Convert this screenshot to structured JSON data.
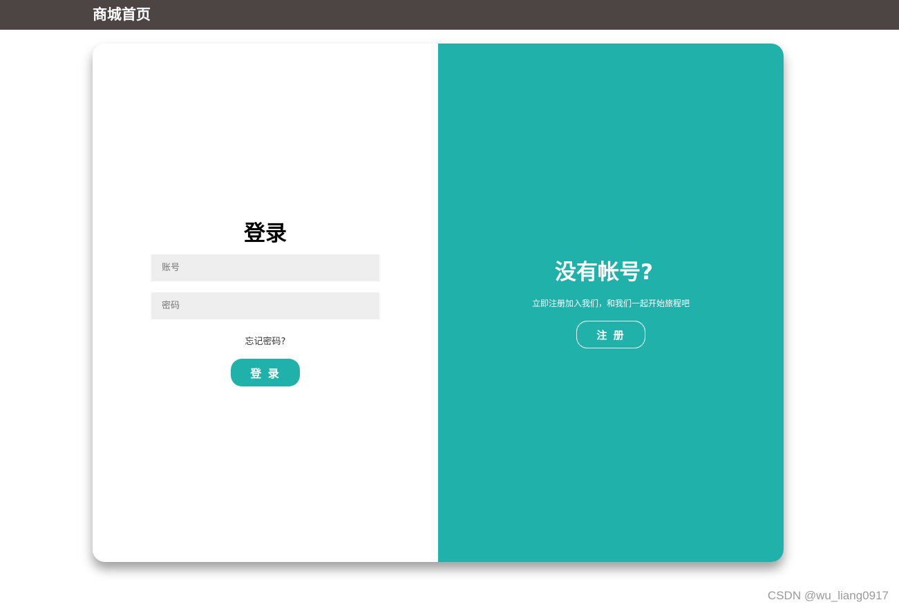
{
  "header": {
    "site_title": "商城首页"
  },
  "login": {
    "title": "登录",
    "account_placeholder": "账号",
    "password_placeholder": "密码",
    "forgot_password": "忘记密码?",
    "submit_label": "登 录"
  },
  "register": {
    "title": "没有帐号?",
    "description": "立即注册加入我们，和我们一起开始旅程吧",
    "button_label": "注 册"
  },
  "watermark": "CSDN @wu_liang0917",
  "colors": {
    "header_bg": "#4d4444",
    "accent": "#20b2aa",
    "input_bg": "#eeeeee"
  }
}
